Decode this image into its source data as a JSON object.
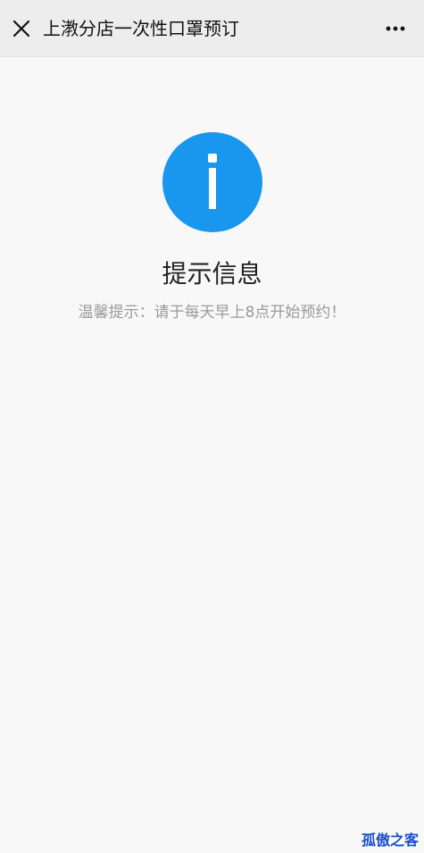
{
  "navbar": {
    "title": "上漖分店一次性口罩预订",
    "close_icon": "close-icon",
    "more_icon": "more-dots-icon"
  },
  "message": {
    "icon": "info-icon",
    "icon_color": "#1996ee",
    "heading": "提示信息",
    "tip": "温馨提示：请于每天早上8点开始预约！"
  },
  "watermark": {
    "text": "孤傲之客",
    "color": "#1a4fc8"
  }
}
